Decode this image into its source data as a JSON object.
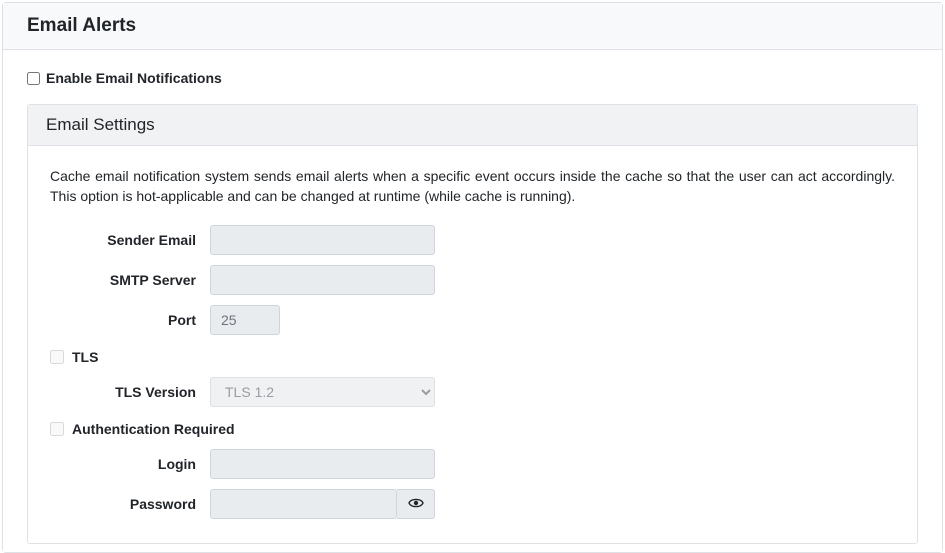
{
  "panel": {
    "title": "Email Alerts",
    "enable_label": "Enable Email Notifications",
    "enable_checked": false
  },
  "settings": {
    "title": "Email Settings",
    "description": "Cache email notification system sends email alerts when a specific event occurs inside the cache so that the user can act accordingly. This option is hot-applicable and can be changed at runtime (while cache is running).",
    "sender_label": "Sender Email",
    "sender_value": "",
    "smtp_label": "SMTP Server",
    "smtp_value": "",
    "port_label": "Port",
    "port_value": "25",
    "tls_label": "TLS",
    "tls_checked": false,
    "tlsver_label": "TLS Version",
    "tlsver_value": "TLS 1.2",
    "auth_label": "Authentication Required",
    "auth_checked": false,
    "login_label": "Login",
    "login_value": "",
    "password_label": "Password",
    "password_value": ""
  }
}
